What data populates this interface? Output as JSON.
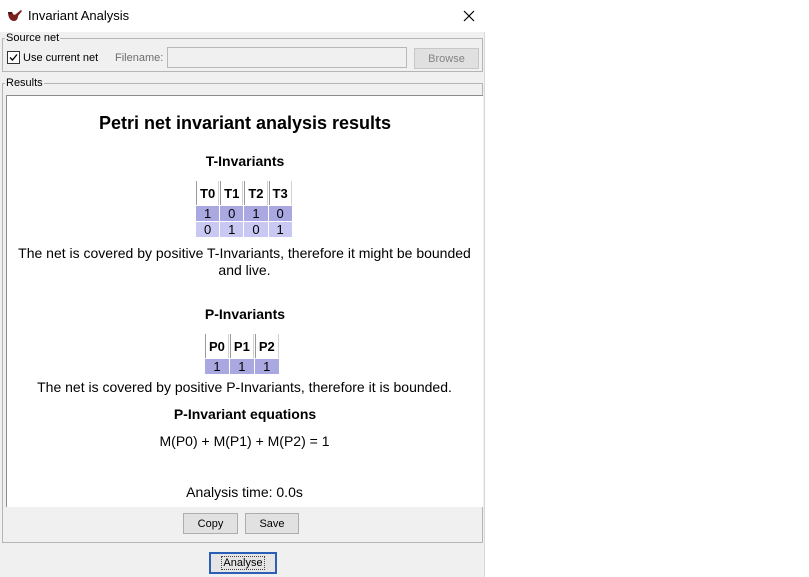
{
  "window": {
    "title": "Invariant Analysis"
  },
  "source_net": {
    "legend": "Source net",
    "use_current_label": "Use current net",
    "use_current_checked": true,
    "filename_label": "Filename:",
    "filename_value": "",
    "browse_label": "Browse"
  },
  "results": {
    "legend": "Results",
    "title": "Petri net invariant analysis results",
    "t_invariants": {
      "heading": "T-Invariants",
      "headers": [
        "T0",
        "T1",
        "T2",
        "T3"
      ],
      "rows": [
        [
          "1",
          "0",
          "1",
          "0"
        ],
        [
          "0",
          "1",
          "0",
          "1"
        ]
      ],
      "summary": "The net is covered by positive T-Invariants, therefore it might be bounded and live."
    },
    "p_invariants": {
      "heading": "P-Invariants",
      "headers": [
        "P0",
        "P1",
        "P2"
      ],
      "rows": [
        [
          "1",
          "1",
          "1"
        ]
      ],
      "summary": "The net is covered by positive P-Invariants, therefore it is bounded."
    },
    "equations": {
      "heading": "P-Invariant equations",
      "text": "M(P0) + M(P1) + M(P2) = 1"
    },
    "analysis_time": "Analysis time: 0.0s"
  },
  "buttons": {
    "copy": "Copy",
    "save": "Save",
    "analyse": "Analyse"
  },
  "colors": {
    "row_primary": "#a9a8e0",
    "row_secondary": "#c8c8f2",
    "focus_border": "#2a5fb5"
  },
  "icons": {
    "app": "tobacco-pipe-icon",
    "close": "close-icon",
    "checkbox": "checkmark-icon"
  }
}
